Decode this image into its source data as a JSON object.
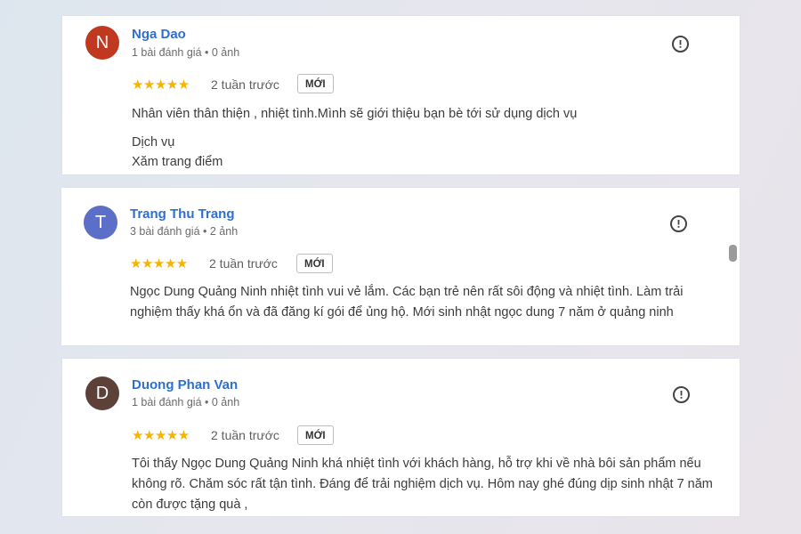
{
  "colors": {
    "accent": "#2f6fd0",
    "star": "#f4b400"
  },
  "reviews": [
    {
      "avatar_letter": "N",
      "avatar_color": "#c0381f",
      "name": "Nga Dao",
      "meta": "1 bài đánh giá • 0 ảnh",
      "rating": 5,
      "stars": "★★★★★",
      "time": "2 tuần trước",
      "badge": "MỚI",
      "text": "Nhân viên thân thiện , nhiệt tình.Mình sẽ giới thiệu bạn bè tới sử dụng dịch vụ",
      "service_label": "Dịch vụ",
      "service_value": "Xăm trang điểm"
    },
    {
      "avatar_letter": "T",
      "avatar_color": "#5b6ec8",
      "name": "Trang Thu Trang",
      "meta": "3 bài đánh giá • 2 ảnh",
      "rating": 5,
      "stars": "★★★★★",
      "time": "2 tuần trước",
      "badge": "MỚI",
      "text": "Ngọc Dung Quảng Ninh nhiệt tình vui vẻ lắm. Các bạn trẻ nên rất sôi động và nhiệt tình. Làm trải nghiệm thấy khá ổn và đã đăng kí gói để ủng hộ. Mới sinh nhật ngọc dung 7 năm ở quảng ninh"
    },
    {
      "avatar_letter": "D",
      "avatar_color": "#5d4037",
      "name": "Duong Phan Van",
      "meta": "1 bài đánh giá • 0 ảnh",
      "rating": 5,
      "stars": "★★★★★",
      "time": "2 tuần trước",
      "badge": "MỚI",
      "text": "Tôi thấy Ngọc Dung Quảng Ninh khá nhiệt tình với khách hàng, hỗ trợ khi về nhà bôi sản phẩm nếu không rõ. Chăm sóc rất tận tình. Đáng để trải nghiệm dịch vụ. Hôm nay ghé đúng dịp sinh nhật 7 năm còn được tặng quà ,"
    }
  ]
}
